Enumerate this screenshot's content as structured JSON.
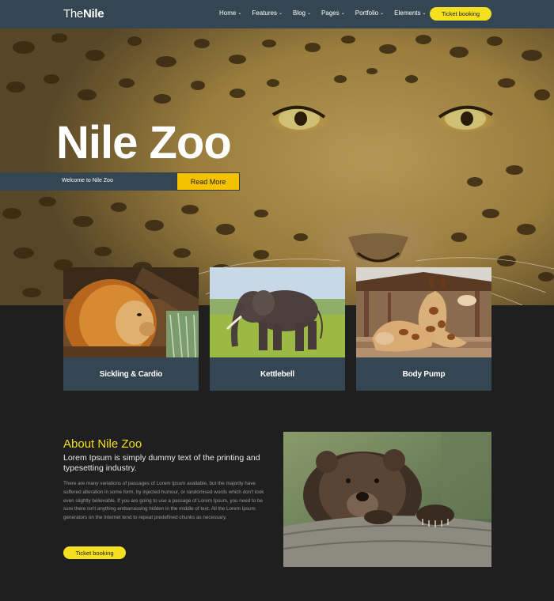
{
  "nav": {
    "logo_prefix": "The",
    "logo_bold": "Nile",
    "items": [
      {
        "label": "Home"
      },
      {
        "label": "Features"
      },
      {
        "label": "Blog"
      },
      {
        "label": "Pages"
      },
      {
        "label": "Portfolio"
      },
      {
        "label": "Elements"
      }
    ],
    "ticket_label": "Ticket booking"
  },
  "hero": {
    "title": "Nile Zoo",
    "welcome": "Welcome to Nile Zoo",
    "read_more": "Read More"
  },
  "cards": [
    {
      "label": "Sickling & Cardio",
      "image": "lion-photo"
    },
    {
      "label": "Kettlebell",
      "image": "elephant-photo"
    },
    {
      "label": "Body Pump",
      "image": "giraffe-photo"
    }
  ],
  "about": {
    "title": "About Nile Zoo",
    "subtitle": "Lorem Ipsum is simply dummy text of the printing and typesetting industry.",
    "body": "There are many variations of passages of Lorem Ipsum available, but the majority have suffered alteration in some form, by injected humour, or randomised words which don't look even slightly believable. If you are going to use a passage of Lorem Ipsum, you need to be sure there isn't anything embarrassing hidden in the middle of text. All the Lorem Ipsum generators on the Internet tend to repeat predefined chunks as necessary.",
    "ticket_label": "Ticket booking",
    "image": "bear-photo"
  },
  "colors": {
    "nav_bg": "#344652",
    "accent_yellow": "#f4e021",
    "read_more_bg": "#f5c200",
    "page_bg": "#1f1f1f"
  }
}
